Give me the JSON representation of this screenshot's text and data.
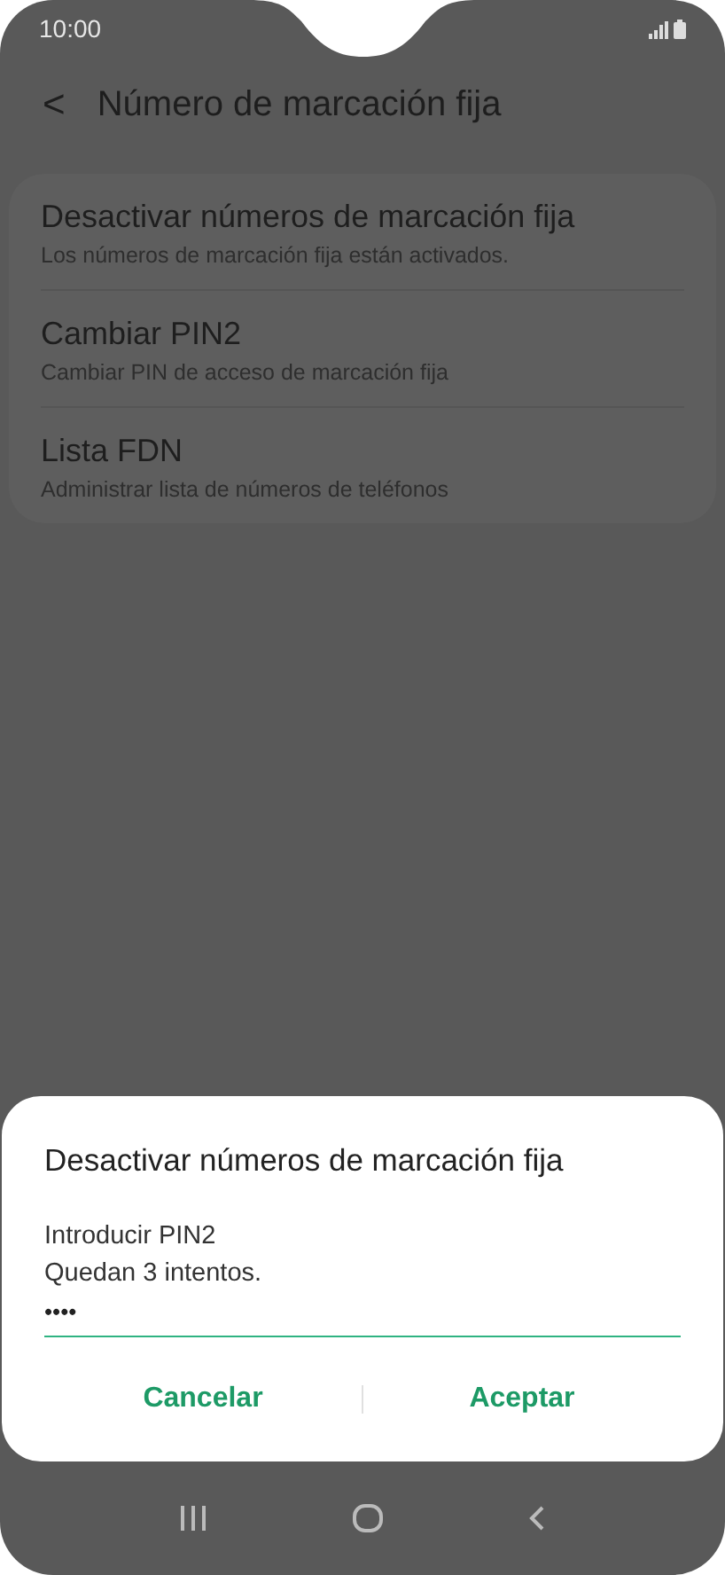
{
  "status_bar": {
    "time": "10:00"
  },
  "header": {
    "back_icon": "<",
    "title": "Número de marcación fija"
  },
  "settings": [
    {
      "title": "Desactivar números de marcación fija",
      "subtitle": "Los números de marcación fija están activados."
    },
    {
      "title": "Cambiar PIN2",
      "subtitle": "Cambiar PIN de acceso de marcación fija"
    },
    {
      "title": "Lista FDN",
      "subtitle": "Administrar lista de números de teléfonos"
    }
  ],
  "dialog": {
    "title": "Desactivar números de marcación fija",
    "lines": [
      "Introducir PIN2",
      "Quedan 3 intentos."
    ],
    "pin_field": {
      "value": "••••"
    },
    "buttons": [
      "Cancelar",
      "Aceptar"
    ]
  }
}
